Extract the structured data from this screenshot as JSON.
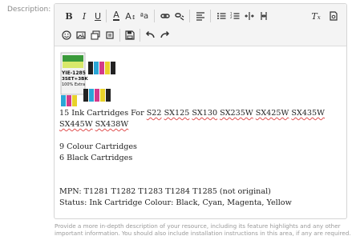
{
  "field_label": "Description:",
  "toolbar": {
    "row1": [
      "bold-button",
      "italic-button",
      "underline-button",
      "font-color-button",
      "font-size-button",
      "font-size-small-button",
      "link-button",
      "unlink-button",
      "align-button",
      "bullet-list-button",
      "numbered-list-button",
      "outdent-button",
      "indent-button",
      "remove-format-button",
      "source-button"
    ],
    "row2": [
      "smiley-button",
      "image-button",
      "media-button",
      "save-button",
      "undo-button",
      "redo-button"
    ]
  },
  "product_image": {
    "label_line1": "YIE-1285",
    "label_line2": "3SET+3BK",
    "label_line3": "100% Extra"
  },
  "content": {
    "title_parts": [
      "15 Ink Cartridges For ",
      "S22",
      " ",
      "SX125",
      " ",
      "SX130",
      " ",
      "SX235W",
      " ",
      "SX425W",
      " ",
      "SX435W",
      " ",
      "SX445W",
      " ",
      "SX438W"
    ],
    "colour_line": "9 Colour Cartridges",
    "black_line": "6 Black Cartridges",
    "mpn_line": "MPN: T1281 T1282 T1283 T1284 T1285 (not original)",
    "status_line": "Status: Ink Cartridge Colour: Black, Cyan, Magenta, Yellow"
  },
  "hint": "Provide a more in-depth description of your resource, including its feature highlights and any other important information. You should also include installation instructions in this area, if any are required.",
  "colors": {
    "toolbar_bg": "#f4f4f4",
    "border": "#d5d5d5",
    "spellcheck": "#e05050"
  }
}
